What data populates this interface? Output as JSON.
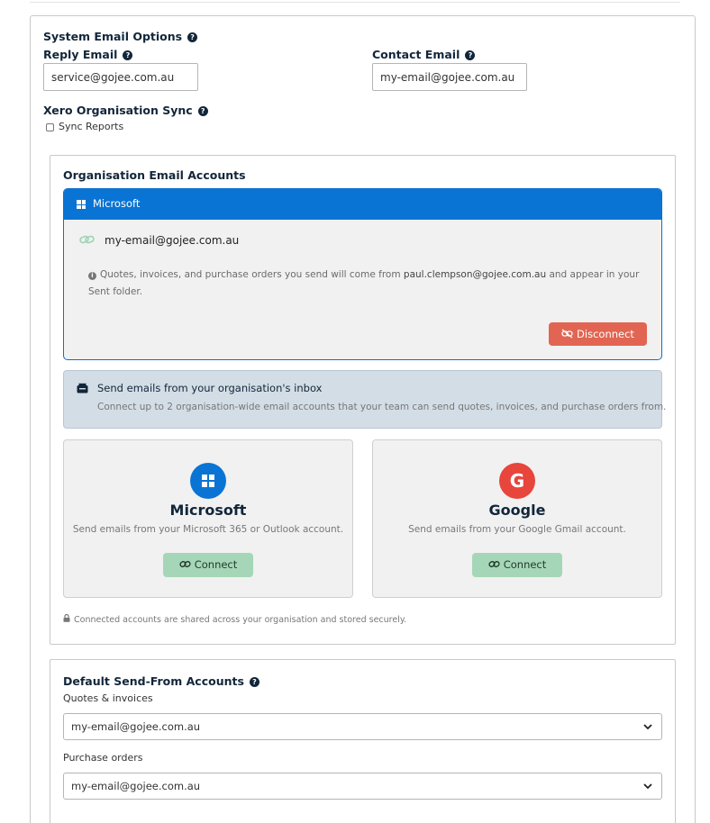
{
  "system": {
    "title": "System Email Options",
    "reply_label": "Reply Email",
    "reply_value": "service@gojee.com.au",
    "contact_label": "Contact Email",
    "contact_value": "my-email@gojee.com.au",
    "xero_label": "Xero Organisation Sync",
    "sync_label": "Sync Reports",
    "help_glyph": "?"
  },
  "org_accounts": {
    "title": "Organisation Email Accounts",
    "connected": {
      "provider": "Microsoft",
      "email": "my-email@gojee.com.au",
      "info_prefix": "Quotes, invoices, and purchase orders you send will come from",
      "info_email": "paul.clempson@gojee.com.au",
      "info_suffix": "and appear in your Sent folder.",
      "disconnect_label": "Disconnect"
    },
    "inbox": {
      "title": "Send emails from your organisation's inbox",
      "desc": "Connect up to 2 organisation-wide email accounts that your team can send quotes, invoices, and purchase orders from."
    },
    "providers": [
      {
        "name": "Microsoft",
        "desc": "Send emails from your Microsoft 365 or Outlook account.",
        "connect_label": "Connect",
        "color": "#0a74d4"
      },
      {
        "name": "Google",
        "desc": "Send emails from your Google Gmail account.",
        "connect_label": "Connect",
        "color": "#e8453c",
        "glyph": "G"
      }
    ],
    "footer_note": "Connected accounts are shared across your organisation and stored securely."
  },
  "defaults": {
    "title": "Default Send-From Accounts",
    "quotes_label": "Quotes & invoices",
    "quotes_value": "my-email@gojee.com.au",
    "po_label": "Purchase orders",
    "po_value": "my-email@gojee.com.au"
  }
}
